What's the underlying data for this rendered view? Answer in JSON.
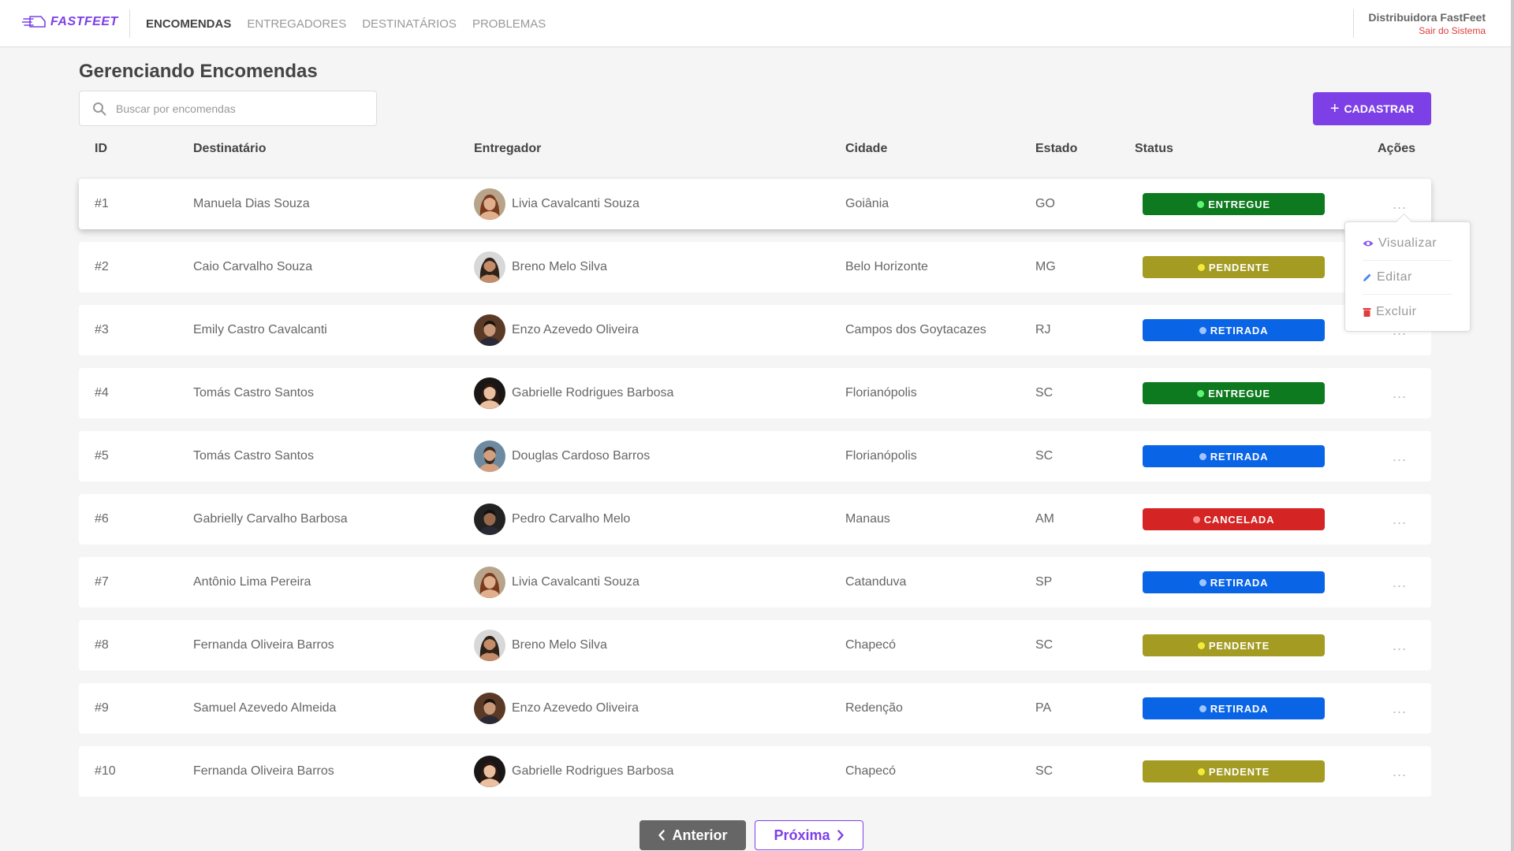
{
  "header": {
    "brand": "FASTFEET",
    "nav": [
      {
        "label": "ENCOMENDAS",
        "active": true
      },
      {
        "label": "ENTREGADORES",
        "active": false
      },
      {
        "label": "DESTINATÁRIOS",
        "active": false
      },
      {
        "label": "PROBLEMAS",
        "active": false
      }
    ],
    "user_name": "Distribuidora FastFeet",
    "logout_label": "Sair do Sistema"
  },
  "page": {
    "title": "Gerenciando Encomendas",
    "search_placeholder": "Buscar por encomendas",
    "add_button_label": "CADASTRAR"
  },
  "table": {
    "columns": [
      "ID",
      "Destinatário",
      "Entregador",
      "Cidade",
      "Estado",
      "Status",
      "Ações"
    ],
    "rows": [
      {
        "id": "#1",
        "recipient": "Manuela Dias Souza",
        "deliveryman": "Livia Cavalcanti Souza",
        "avatar": "avatar-female-curly",
        "city": "Goiânia",
        "state": "GO",
        "status": "ENTREGUE",
        "actions": "...",
        "highlight": true
      },
      {
        "id": "#2",
        "recipient": "Caio Carvalho Souza",
        "deliveryman": "Breno Melo Silva",
        "avatar": "avatar-male-long-hair",
        "city": "Belo Horizonte",
        "state": "MG",
        "status": "PENDENTE",
        "actions": "..."
      },
      {
        "id": "#3",
        "recipient": "Emily Castro Cavalcanti",
        "deliveryman": "Enzo Azevedo Oliveira",
        "avatar": "avatar-male-suit",
        "city": "Campos dos Goytacazes",
        "state": "RJ",
        "status": "RETIRADA",
        "actions": "..."
      },
      {
        "id": "#4",
        "recipient": "Tomás Castro Santos",
        "deliveryman": "Gabrielle Rodrigues Barbosa",
        "avatar": "avatar-female-dark",
        "city": "Florianópolis",
        "state": "SC",
        "status": "ENTREGUE",
        "actions": "..."
      },
      {
        "id": "#5",
        "recipient": "Tomás Castro Santos",
        "deliveryman": "Douglas Cardoso Barros",
        "avatar": "avatar-male-beard",
        "city": "Florianópolis",
        "state": "SC",
        "status": "RETIRADA",
        "actions": "..."
      },
      {
        "id": "#6",
        "recipient": "Gabrielly Carvalho Barbosa",
        "deliveryman": "Pedro Carvalho Melo",
        "avatar": "avatar-male-dark",
        "city": "Manaus",
        "state": "AM",
        "status": "CANCELADA",
        "actions": "..."
      },
      {
        "id": "#7",
        "recipient": "Antônio Lima Pereira",
        "deliveryman": "Livia Cavalcanti Souza",
        "avatar": "avatar-female-curly",
        "city": "Catanduva",
        "state": "SP",
        "status": "RETIRADA",
        "actions": "..."
      },
      {
        "id": "#8",
        "recipient": "Fernanda Oliveira Barros",
        "deliveryman": "Breno Melo Silva",
        "avatar": "avatar-male-long-hair",
        "city": "Chapecó",
        "state": "SC",
        "status": "PENDENTE",
        "actions": "..."
      },
      {
        "id": "#9",
        "recipient": "Samuel Azevedo Almeida",
        "deliveryman": "Enzo Azevedo Oliveira",
        "avatar": "avatar-male-suit",
        "city": "Redenção",
        "state": "PA",
        "status": "RETIRADA",
        "actions": "..."
      },
      {
        "id": "#10",
        "recipient": "Fernanda Oliveira Barros",
        "deliveryman": "Gabrielle Rodrigues Barbosa",
        "avatar": "avatar-female-dark",
        "city": "Chapecó",
        "state": "SC",
        "status": "PENDENTE",
        "actions": "..."
      }
    ]
  },
  "status_colors": {
    "ENTREGUE": {
      "bg": "#0d7a1f",
      "dot": "#5ef575"
    },
    "PENDENTE": {
      "bg": "#a39b22",
      "dot": "#f3ea3a"
    },
    "RETIRADA": {
      "bg": "#0a64e6",
      "dot": "#9fc4ff"
    },
    "CANCELADA": {
      "bg": "#d42424",
      "dot": "#ff8c8c"
    }
  },
  "dropdown": {
    "items": [
      {
        "label": "Visualizar",
        "icon": "eye-icon",
        "color": "#8e5be8"
      },
      {
        "label": "Editar",
        "icon": "pencil-icon",
        "color": "#4d85ee"
      },
      {
        "label": "Excluir",
        "icon": "trash-icon",
        "color": "#de3b3b"
      }
    ]
  },
  "pagination": {
    "prev_label": "Anterior",
    "next_label": "Próxima"
  },
  "colors": {
    "accent": "#7d40e7",
    "logout": "#de3b3b"
  }
}
